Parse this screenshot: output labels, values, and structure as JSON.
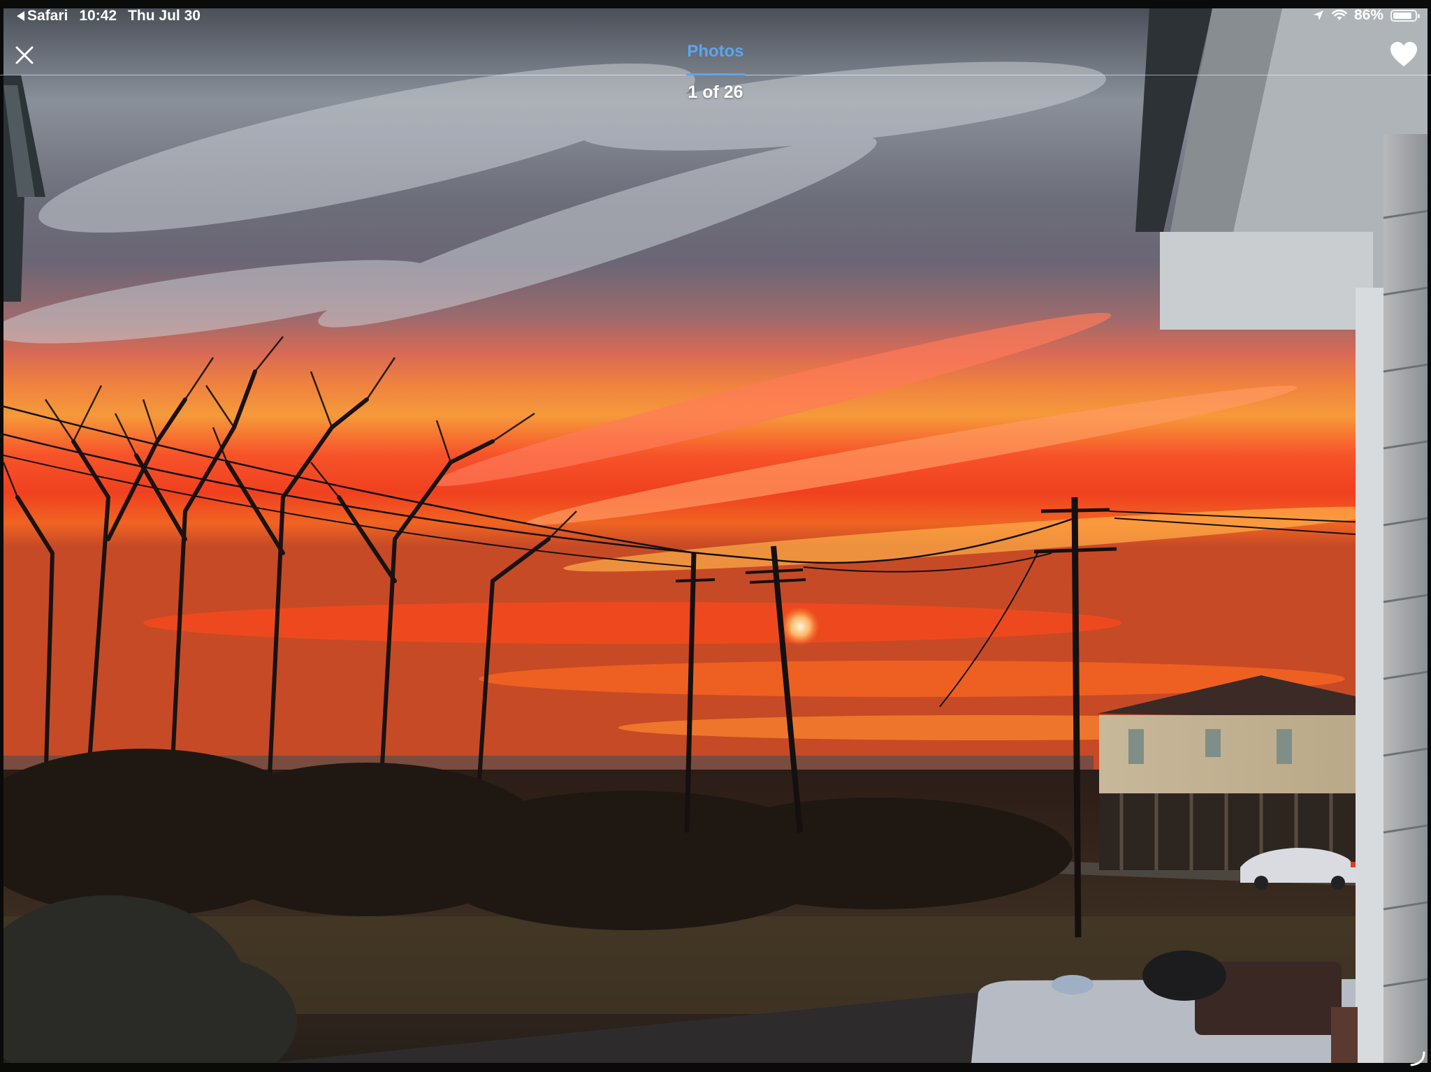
{
  "status_bar": {
    "back_app": "Safari",
    "time": "10:42",
    "date": "Thu Jul 30",
    "battery_percent": "86%",
    "battery_level": 0.86,
    "icons": [
      "location-arrow-icon",
      "wifi-icon",
      "battery-icon"
    ]
  },
  "nav": {
    "close_icon": "close-icon",
    "active_tab": "Photos",
    "favorite_icon": "heart-icon",
    "accent_color": "#5aa6ee"
  },
  "viewer": {
    "counter": "1 of 26"
  }
}
